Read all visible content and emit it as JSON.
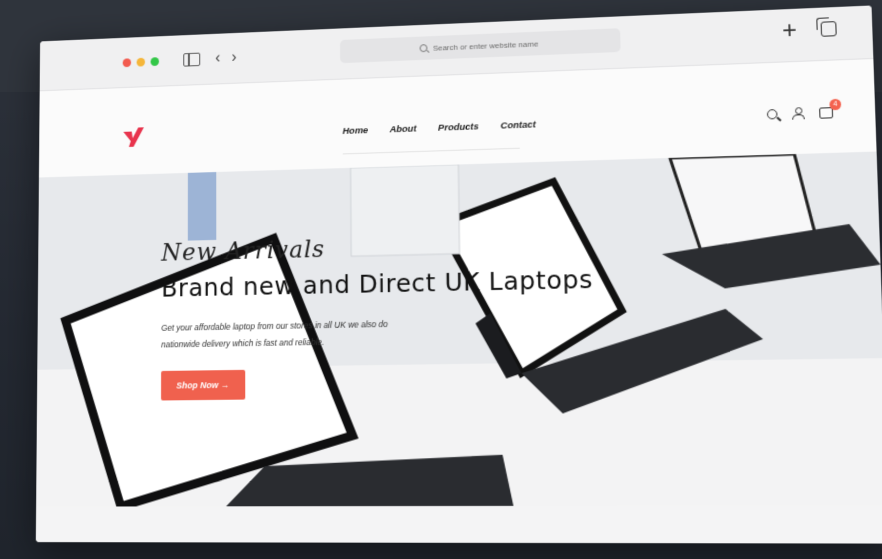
{
  "browser": {
    "address_placeholder": "Search or enter website name"
  },
  "site": {
    "nav": [
      {
        "label": "Home"
      },
      {
        "label": "About"
      },
      {
        "label": "Products"
      },
      {
        "label": "Contact"
      }
    ],
    "cart_count": "4"
  },
  "hero": {
    "eyebrow": "New Arrivals",
    "title": "Brand new and Direct UK Laptops",
    "description": "Get your affordable laptop from our stores in all UK we also do nationwide delivery which is fast and reliable.",
    "cta_label": "Shop Now →"
  },
  "colors": {
    "accent": "#f0614e",
    "logo": "#e8344d"
  }
}
